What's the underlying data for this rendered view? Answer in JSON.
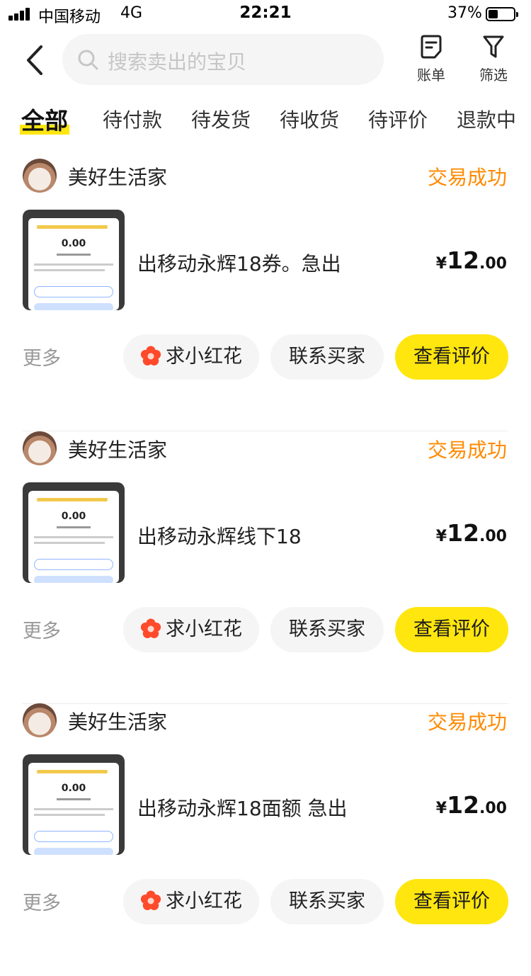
{
  "status_bar": {
    "carrier": "中国移动",
    "network": "4G",
    "time": "22:21",
    "battery": "37%"
  },
  "header": {
    "search_placeholder": "搜索卖出的宝贝",
    "bill_label": "账单",
    "filter_label": "筛选"
  },
  "tabs": [
    {
      "label": "全部",
      "active": true
    },
    {
      "label": "待付款"
    },
    {
      "label": "待发货"
    },
    {
      "label": "待收货"
    },
    {
      "label": "待评价"
    },
    {
      "label": "退款中"
    }
  ],
  "orders": [
    {
      "seller": "美好生活家",
      "status": "交易成功",
      "title": "出移动永辉18券。急出",
      "price_currency": "¥",
      "price_int": "12",
      "price_dec": ".00",
      "thumb_amount": "0.00",
      "more": "更多",
      "flower_btn": "求小红花",
      "contact_btn": "联系买家",
      "review_btn": "查看评价"
    },
    {
      "seller": "美好生活家",
      "status": "交易成功",
      "title": "出移动永辉线下18",
      "price_currency": "¥",
      "price_int": "12",
      "price_dec": ".00",
      "thumb_amount": "0.00",
      "more": "更多",
      "flower_btn": "求小红花",
      "contact_btn": "联系买家",
      "review_btn": "查看评价"
    },
    {
      "seller": "美好生活家",
      "status": "交易成功",
      "title": "出移动永辉18面额 急出",
      "price_currency": "¥",
      "price_int": "12",
      "price_dec": ".00",
      "thumb_amount": "0.00",
      "more": "更多",
      "flower_btn": "求小红花",
      "contact_btn": "联系买家",
      "review_btn": "查看评价"
    }
  ],
  "colors": {
    "accent_yellow": "#ffe60f",
    "status_orange": "#ff8a00",
    "flower_red": "#ff4a2b"
  },
  "icons": [
    "back-arrow-icon",
    "search-icon",
    "bill-icon",
    "filter-icon",
    "flower-icon"
  ]
}
